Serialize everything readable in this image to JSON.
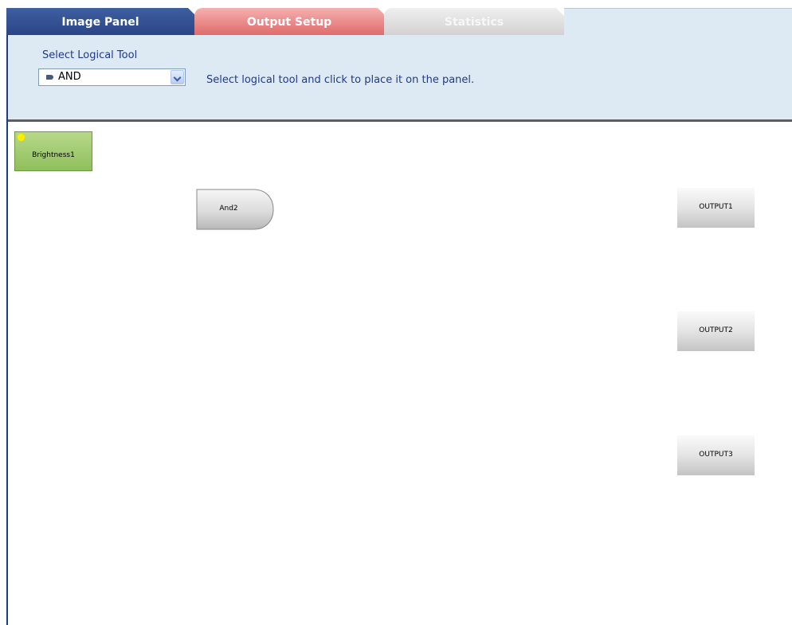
{
  "tabs": [
    {
      "label": "Image Panel",
      "state": "active"
    },
    {
      "label": "Output Setup",
      "state": "inactive"
    },
    {
      "label": "Statistics",
      "state": "disabled"
    }
  ],
  "toolbar": {
    "select_label": "Select Logical Tool",
    "selected_tool": "AND",
    "selected_tool_icon": "and-gate-icon",
    "hint": "Select logical tool and click to place it on the panel."
  },
  "canvas": {
    "source_node": {
      "label": "Brightness1",
      "icon": "light-bulb-icon"
    },
    "gate_node": {
      "label": "And2",
      "type": "AND"
    },
    "outputs": [
      {
        "label": "OUTPUT1"
      },
      {
        "label": "OUTPUT2"
      },
      {
        "label": "OUTPUT3"
      }
    ]
  },
  "colors": {
    "active_tab": "#2b4587",
    "output_tab": "#e06b6b",
    "statistics_tab": "#d3d1d1",
    "toolbar_bg": "#dde9f3",
    "source_node": "#9ac66a",
    "text_blue": "#1f3a8a"
  }
}
